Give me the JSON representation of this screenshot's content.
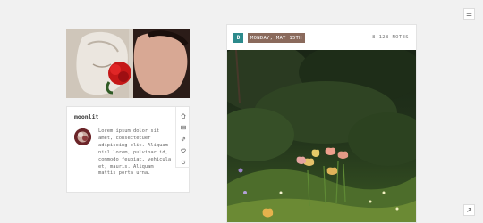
{
  "blog": {
    "name": "moonlit",
    "bio": "Lorem ipsum dolor sit amet, consectetuer adipiscing elit. Aliquam nisl lorem, pulvinar id, commodo feugiat, vehicula et, mauris. Aliquam mattis porta urna."
  },
  "post": {
    "avatar_letter": "D",
    "date": "MONDAY, MAY 15TH",
    "notes": "8,128 NOTES"
  },
  "nav": {
    "icons": [
      "home-icon",
      "archive-icon",
      "link-icon",
      "heart-icon",
      "refresh-icon"
    ]
  },
  "colors": {
    "background": "#f1f1f1",
    "post_avatar": "#2c8a8c",
    "date_badge": "#8a6a5c"
  }
}
